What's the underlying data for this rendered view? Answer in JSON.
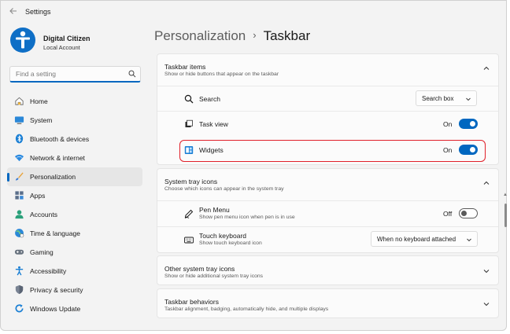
{
  "window": {
    "title": "Settings"
  },
  "profile": {
    "name": "Digital Citizen",
    "account_type": "Local Account"
  },
  "search": {
    "placeholder": "Find a setting"
  },
  "sidebar": {
    "items": [
      {
        "label": "Home",
        "icon": "home-icon"
      },
      {
        "label": "System",
        "icon": "system-icon"
      },
      {
        "label": "Bluetooth & devices",
        "icon": "bluetooth-icon"
      },
      {
        "label": "Network & internet",
        "icon": "wifi-icon"
      },
      {
        "label": "Personalization",
        "icon": "brush-icon",
        "active": true
      },
      {
        "label": "Apps",
        "icon": "apps-icon"
      },
      {
        "label": "Accounts",
        "icon": "accounts-icon"
      },
      {
        "label": "Time & language",
        "icon": "globe-icon"
      },
      {
        "label": "Gaming",
        "icon": "gamepad-icon"
      },
      {
        "label": "Accessibility",
        "icon": "accessibility-icon"
      },
      {
        "label": "Privacy & security",
        "icon": "shield-icon"
      },
      {
        "label": "Windows Update",
        "icon": "update-icon"
      }
    ]
  },
  "breadcrumb": {
    "parent": "Personalization",
    "separator": "›",
    "current": "Taskbar"
  },
  "taskbar_items": {
    "title": "Taskbar items",
    "subtitle": "Show or hide buttons that appear on the taskbar",
    "search": {
      "label": "Search",
      "value": "Search box"
    },
    "task_view": {
      "label": "Task view",
      "state": "On"
    },
    "widgets": {
      "label": "Widgets",
      "state": "On"
    }
  },
  "system_tray": {
    "title": "System tray icons",
    "subtitle": "Choose which icons can appear in the system tray",
    "pen_menu": {
      "label": "Pen Menu",
      "description": "Show pen menu icon when pen is in use",
      "state": "Off"
    },
    "touch_keyboard": {
      "label": "Touch keyboard",
      "description": "Show touch keyboard icon",
      "value": "When no keyboard attached"
    }
  },
  "other_tray": {
    "title": "Other system tray icons",
    "subtitle": "Show or hide additional system tray icons"
  },
  "behaviors": {
    "title": "Taskbar behaviors",
    "subtitle": "Taskbar alignment, badging, automatically hide, and multiple displays"
  },
  "colors": {
    "accent": "#0067c0",
    "highlight": "#e0202a"
  }
}
